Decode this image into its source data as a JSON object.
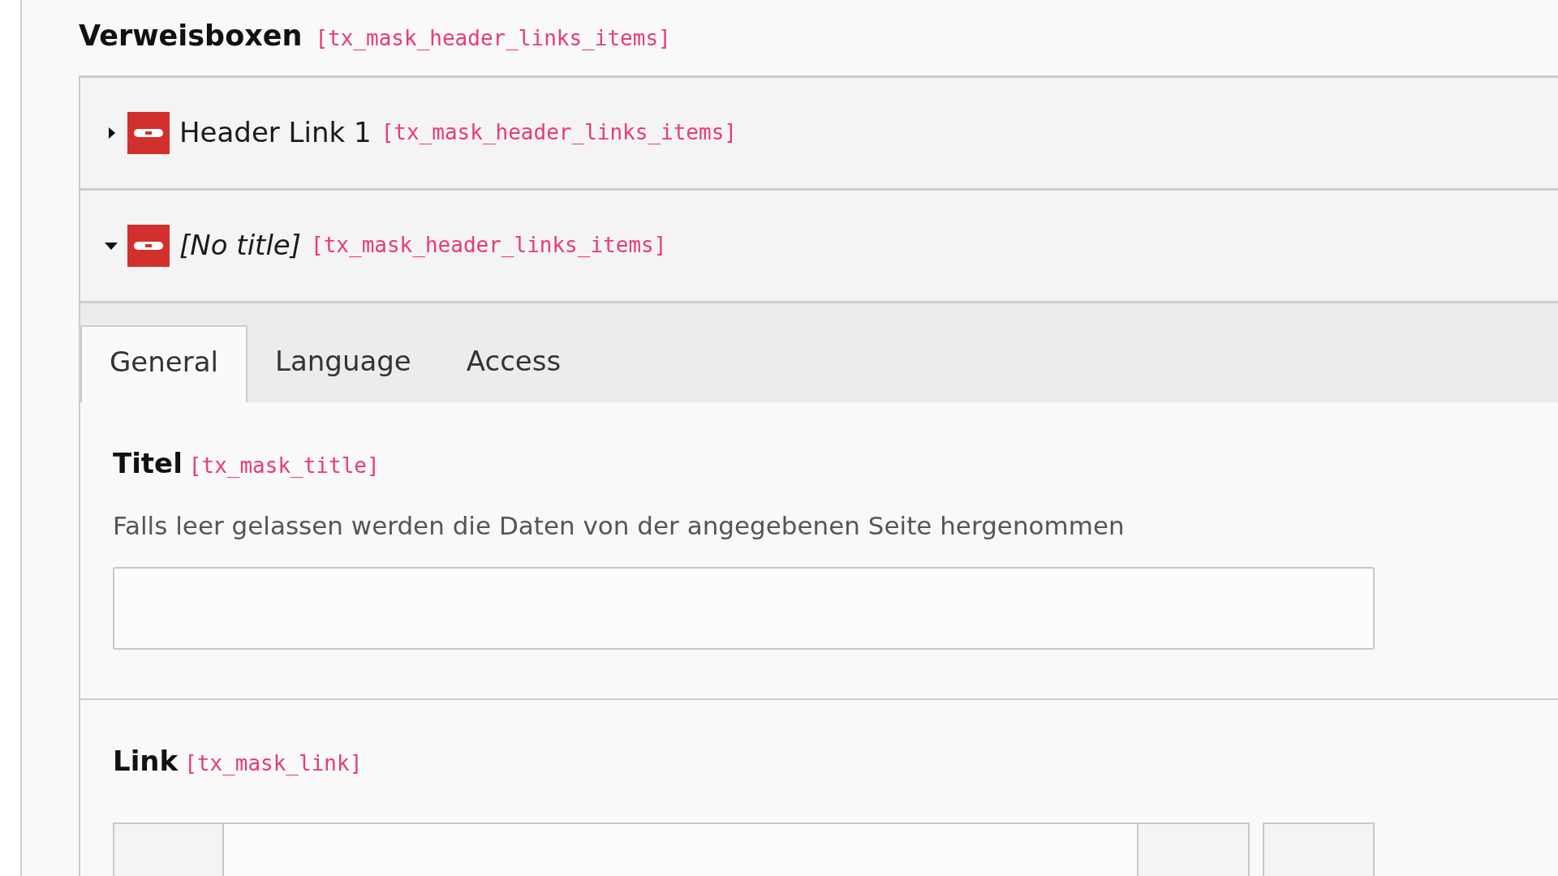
{
  "field": {
    "label": "Verweisboxen",
    "key": "[tx_mask_header_links_items]"
  },
  "records": [
    {
      "title": "Header Link 1",
      "untitled": false,
      "key": "[tx_mask_header_links_items]",
      "expanded": false
    },
    {
      "title": "[No title]",
      "untitled": true,
      "key": "[tx_mask_header_links_items]",
      "expanded": true
    }
  ],
  "tabs": [
    {
      "label": "General",
      "selected": true
    },
    {
      "label": "Language",
      "selected": false
    },
    {
      "label": "Access",
      "selected": false
    }
  ],
  "fields": [
    {
      "kind": "text",
      "label": "Titel",
      "key": "[tx_mask_title]",
      "description": "Falls leer gelassen werden die Daten von der angegebenen Seite hergenommen"
    },
    {
      "kind": "link",
      "label": "Link",
      "key": "[tx_mask_link]"
    }
  ]
}
